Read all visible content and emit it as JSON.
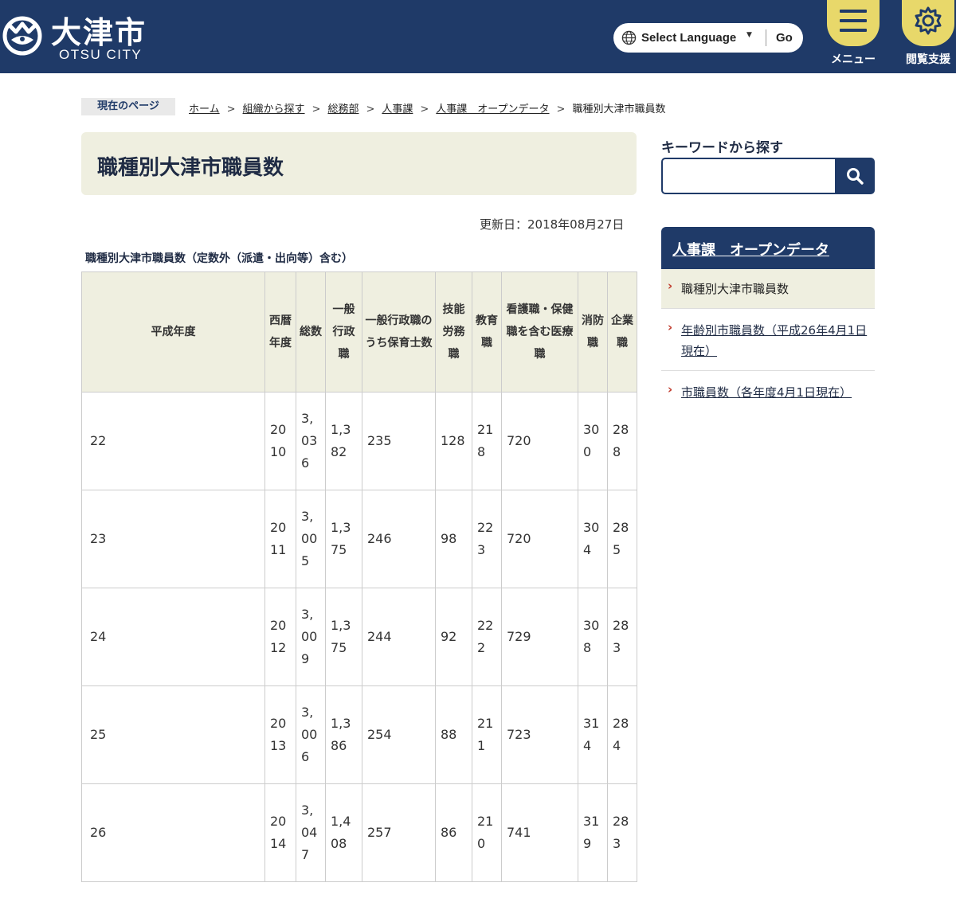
{
  "header": {
    "logo_kanji": "大津市",
    "logo_roman": "OTSU CITY",
    "language_label": "Select Language",
    "language_caret": "▼",
    "go_label": "Go",
    "menu_label": "メニュー",
    "support_label": "閲覧支援",
    "brand_color": "#1f3a68",
    "accent_color": "#e8d86a"
  },
  "breadcrumb": {
    "label": "現在のページ",
    "items": [
      "ホーム",
      "組織から探す",
      "総務部",
      "人事課",
      "人事課　オープンデータ"
    ],
    "current": "職種別大津市職員数",
    "separator": ">"
  },
  "main": {
    "title": "職種別大津市職員数",
    "updated": "更新日：2018年08月27日",
    "caption": "職種別大津市職員数（定数外（派遣・出向等）含む）",
    "table": {
      "headers": [
        "平成年度",
        "西暦年度",
        "総数",
        "一般行政職",
        "一般行政職のうち保育士数",
        "技能労務職",
        "教育職",
        "看護職・保健職を含む医療職",
        "消防職",
        "企業職"
      ],
      "rows": [
        [
          "22",
          "2010",
          "3,036",
          "1,382",
          "235",
          "128",
          "218",
          "720",
          "300",
          "288"
        ],
        [
          "23",
          "2011",
          "3,005",
          "1,375",
          "246",
          "98",
          "223",
          "720",
          "304",
          "285"
        ],
        [
          "24",
          "2012",
          "3,009",
          "1,375",
          "244",
          "92",
          "222",
          "729",
          "308",
          "283"
        ],
        [
          "25",
          "2013",
          "3,006",
          "1,386",
          "254",
          "88",
          "211",
          "723",
          "314",
          "284"
        ],
        [
          "26",
          "2014",
          "3,047",
          "1,408",
          "257",
          "86",
          "210",
          "741",
          "319",
          "283"
        ]
      ]
    }
  },
  "sidebar": {
    "keyword_title": "キーワードから探す",
    "search_value": "",
    "panel_title": "人事課　オープンデータ",
    "items": [
      {
        "label": "職種別大津市職員数",
        "current": true
      },
      {
        "label": "年齢別市職員数（平成26年4月1日現在）",
        "current": false
      },
      {
        "label": "市職員数（各年度4月1日現在）",
        "current": false
      }
    ],
    "chevron": "›"
  }
}
